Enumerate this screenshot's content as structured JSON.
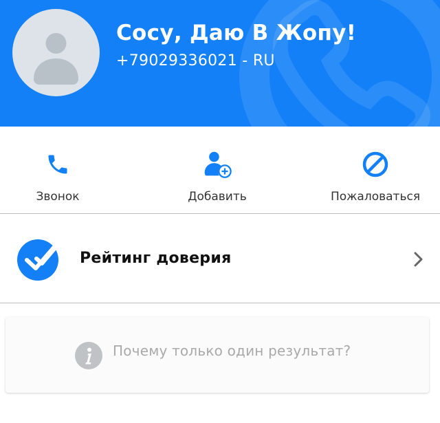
{
  "header": {
    "contact_name": "Сосу, Даю В Жопу!",
    "contact_phone": "+79029336021 - RU",
    "background_color": "#1480f7",
    "avatar_icon": "person-icon"
  },
  "actions": [
    {
      "label": "Звонок",
      "icon": "phone-icon"
    },
    {
      "label": "Добавить",
      "icon": "add-contact-icon"
    },
    {
      "label": "Пожаловаться",
      "icon": "block-icon"
    }
  ],
  "rating": {
    "label": "Рейтинг доверия",
    "icon": "check-badge-icon",
    "chevron_icon": "chevron-right-icon"
  },
  "info": {
    "text": "Почему только один результат?",
    "icon": "info-icon"
  },
  "colors": {
    "accent": "#1480f7",
    "divider": "#bdbdbd",
    "muted_text": "#a9a9a9"
  }
}
